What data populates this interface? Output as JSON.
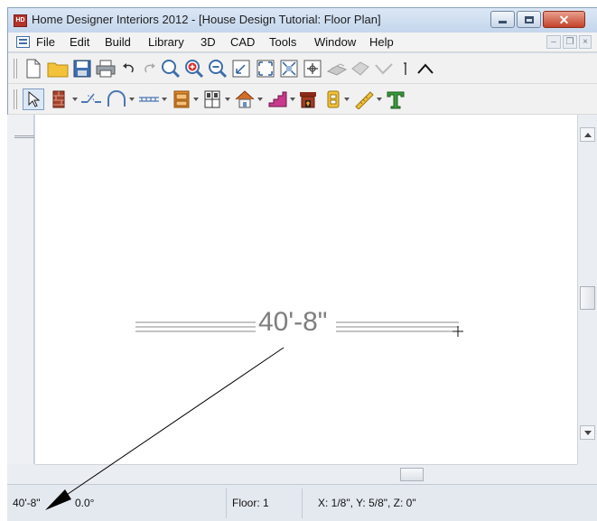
{
  "window": {
    "title": "Home Designer Interiors 2012 - [House Design Tutorial: Floor Plan]",
    "app_icon_text": "HD"
  },
  "menu": {
    "items": [
      "File",
      "Edit",
      "Build",
      "Library",
      "3D",
      "CAD",
      "Tools",
      "Window",
      "Help"
    ]
  },
  "toolbar_top": {
    "icons": [
      "new-file-icon",
      "open-folder-icon",
      "save-icon",
      "print-icon",
      "undo-icon",
      "redo-icon",
      "zoom-icon",
      "zoom-in-icon",
      "zoom-out-icon",
      "undo-zoom-icon",
      "fill-window-icon",
      "fill-window-building-icon",
      "swap-view-icon",
      "render-icon",
      "camera-icon",
      "checkmark-icon",
      "cursor-line-icon",
      "up-arrow-icon"
    ]
  },
  "toolbar_bottom": {
    "icons": [
      "select-objects-icon",
      "wall-tools-icon",
      "door-tools-icon",
      "arch-tools-icon",
      "railing-tools-icon",
      "cabinet-tools-icon",
      "window-tools-icon",
      "roof-tools-icon",
      "stairs-tools-icon",
      "fireplace-tools-icon",
      "electrical-tools-icon",
      "dimension-tools-icon",
      "text-tools-icon"
    ]
  },
  "drawing": {
    "dimension_label": "40'-8\""
  },
  "statusbar": {
    "length": "40'-8\"",
    "angle": "0.0°",
    "floor": "Floor: 1",
    "coordinates": "X: 1/8\", Y: 5/8\", Z: 0\""
  },
  "colors": {
    "title_bar": "#c4d6ec",
    "close_button": "#c4422b",
    "canvas": "#ffffff",
    "dimension_text": "#7f7f7f"
  }
}
